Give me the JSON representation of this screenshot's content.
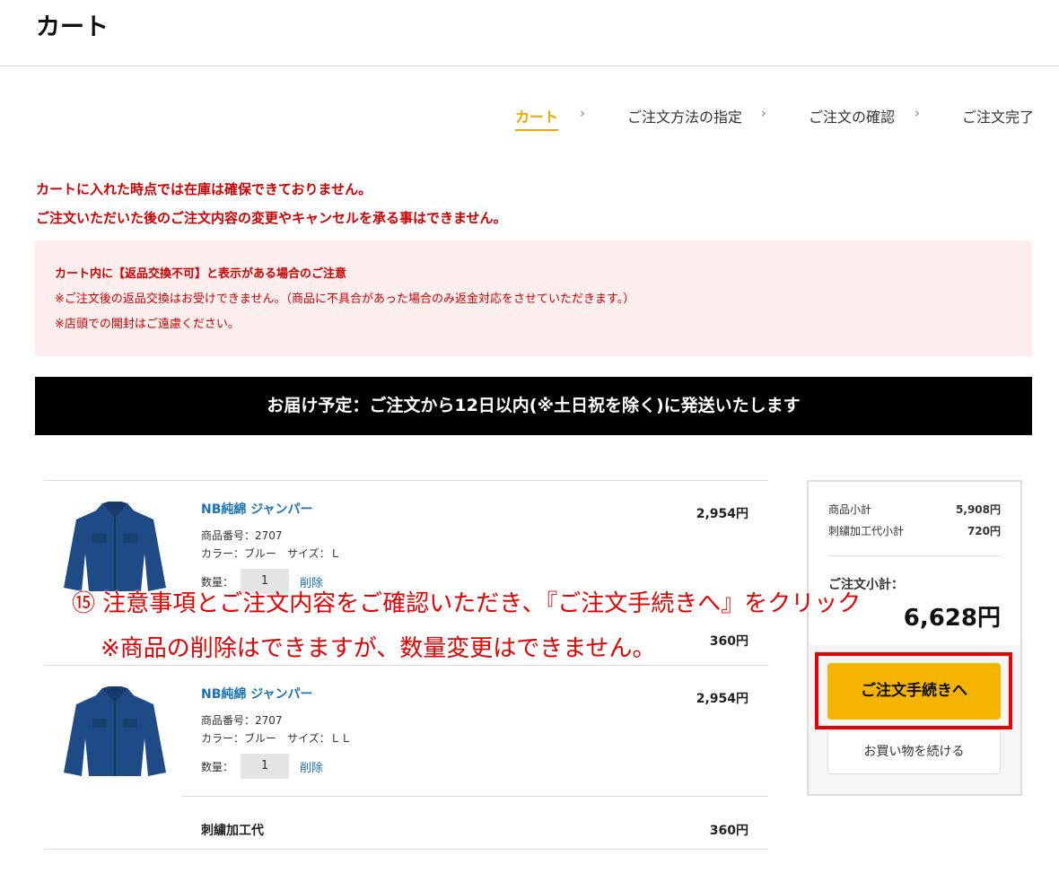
{
  "header": {
    "title": "カート"
  },
  "steps": [
    {
      "label": "カート"
    },
    {
      "label": "ご注文方法の指定"
    },
    {
      "label": "ご注文の確認"
    },
    {
      "label": "ご注文完了"
    }
  ],
  "step_separator": "›",
  "warnings": [
    "カートに入れた時点では在庫は確保できておりません。",
    "ご注文いただいた後のご注文内容の変更やキャンセルを承る事はできません。"
  ],
  "notice": {
    "heading": "カート内に【返品交換不可】と表示がある場合のご注意",
    "lines": [
      "※ご注文後の返品交換はお受けできません。（商品に不具合があった場合のみ返金対応をさせていただきます。）",
      "※店頭での開封はご遠慮ください。"
    ]
  },
  "delivery_banner": "お届け予定：ご注文から12日以内(※土日祝を除く)に発送いたします",
  "items": [
    {
      "name": "NB純綿 ジャンパー",
      "product_no": "商品番号：2707",
      "variant": "カラー：ブルー　サイズ：Ｌ",
      "price": "2,954円",
      "qty_label": "数量：",
      "qty": "1",
      "delete_label": "削除",
      "embroidery_price": "360円"
    },
    {
      "name": "NB純綿 ジャンパー",
      "product_no": "商品番号：2707",
      "variant": "カラー：ブルー　サイズ：ＬＬ",
      "price": "2,954円",
      "qty_label": "数量：",
      "qty": "1",
      "delete_label": "削除",
      "embroidery_label": "刺繍加工代",
      "embroidery_price": "360円"
    }
  ],
  "summary": {
    "subtotal_label": "商品小計",
    "subtotal": "5,908円",
    "embroidery_label": "刺繍加工代小計",
    "embroidery": "720円",
    "total_label": "ご注文小計：",
    "total": "6,628円",
    "checkout_label": "ご注文手続きへ",
    "continue_label": "お買い物を続ける"
  },
  "annotation": {
    "line1": "⑮ 注意事項とご注文内容をご確認いただき､『ご注文手続きへ』をクリック",
    "line2": "※商品の削除はできますが、数量変更はできません。"
  },
  "colors": {
    "accent": "#f0a500",
    "button": "#f5b400",
    "warning": "#d00000",
    "link": "#1a73b8",
    "notice_bg": "#fdeeee",
    "highlight": "#e60000",
    "jacket": "#1e4a86"
  }
}
